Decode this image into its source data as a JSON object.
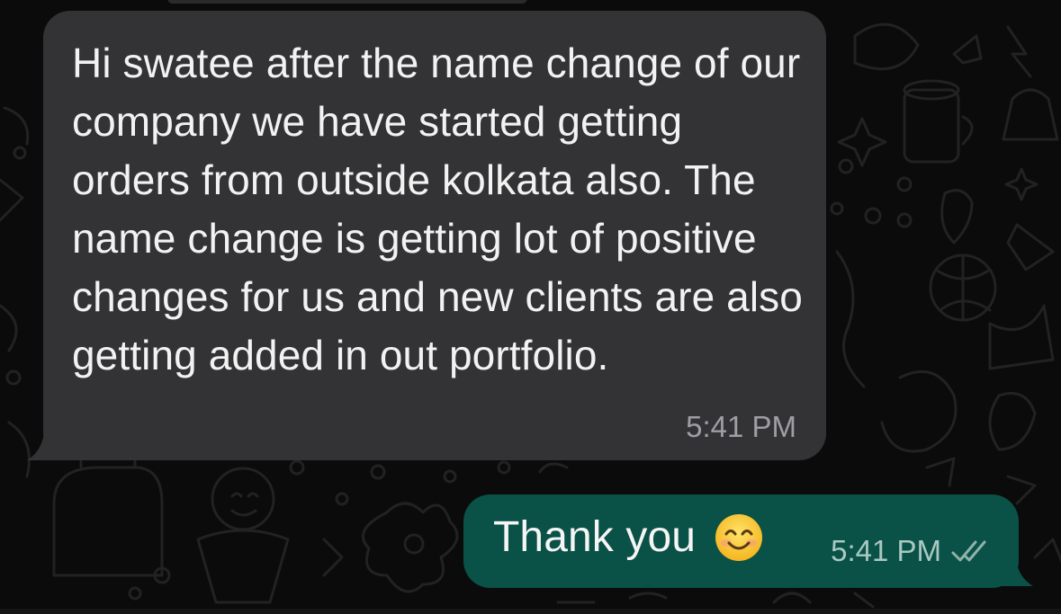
{
  "chat": {
    "incoming_message": {
      "text": "Hi swatee after the name change of our company we have started getting orders from outside kolkata also. The name change is getting lot of positive changes for us and new clients are also getting added in out portfolio.",
      "time": "5:41 PM"
    },
    "outgoing_message": {
      "text": "Thank you",
      "emoji": "smiling-face-with-smiling-eyes",
      "time": "5:41 PM",
      "status": "read-double-tick"
    }
  },
  "colors": {
    "background": "#0b0b0b",
    "incoming_bubble": "#333335",
    "outgoing_bubble": "#0a5147",
    "message_text": "#f2f2f2",
    "timestamp": "#9e9ea3",
    "doodle": "#1f1f1f"
  }
}
